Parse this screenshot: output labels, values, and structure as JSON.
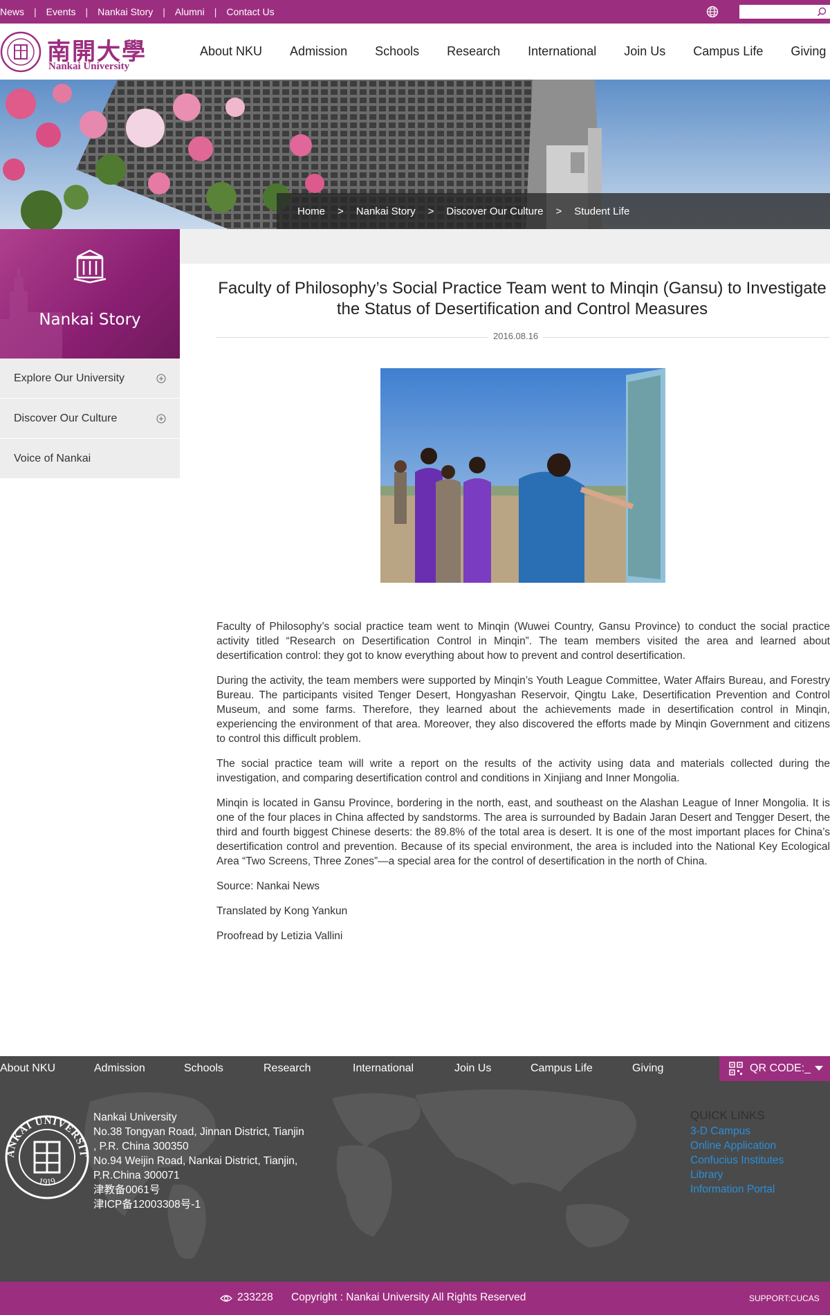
{
  "topbar": {
    "links": [
      "News",
      "Events",
      "Nankai Story",
      "Alumni",
      "Contact Us"
    ],
    "search_placeholder": ""
  },
  "logo": {
    "chinese_name": "南開大學",
    "english_name": "Nankai University"
  },
  "nav": {
    "items": [
      "About NKU",
      "Admission",
      "Schools",
      "Research",
      "International",
      "Join Us",
      "Campus Life",
      "Giving"
    ]
  },
  "breadcrumb": {
    "items": [
      "Home",
      "Nankai Story",
      "Discover Our Culture",
      "Student Life"
    ],
    "separator": ">"
  },
  "sidebar": {
    "title": "Nankai Story",
    "items": [
      {
        "label": "Explore Our University",
        "icon": "plus-circle-icon"
      },
      {
        "label": "Discover Our Culture",
        "icon": "plus-circle-icon"
      },
      {
        "label": "Voice of Nankai"
      }
    ]
  },
  "article": {
    "title_line1": "Faculty of Philosophy’s Social Practice Team went to Minqin (Gansu) to Investigate",
    "title_line2": "the Status of Desertification and Control Measures",
    "date": "2016.08.16",
    "paragraphs": [
      "Faculty of Philosophy’s social practice team went to Minqin (Wuwei Country, Gansu Province) to conduct the social practice activity titled “Research on Desertification Control in Minqin”. The team members visited the area and learned about desertification control: they got to know everything about how to prevent and control desertification.",
      "During the activity, the team members were supported by Minqin’s Youth League Committee, Water Affairs Bureau, and Forestry Bureau. The participants visited Tenger Desert, Hongyashan Reservoir, Qingtu Lake, Desertification Prevention and Control Museum, and some farms. Therefore, they learned about the achievements made in desertification control in Minqin, experiencing the environment of that area. Moreover, they also discovered the efforts made by Minqin Government and citizens to control this difficult problem.",
      "The social practice team will write a report on the results of the activity using data and materials collected during the investigation, and comparing desertification control and conditions in Xinjiang and Inner Mongolia.",
      "Minqin is located in Gansu Province, bordering in the north, east, and southeast on the Alashan League of Inner Mongolia. It is one of the four places in China affected by sandstorms. The area is surrounded by Badain Jaran Desert and Tengger Desert, the third and fourth biggest Chinese deserts: the 89.8% of the total area is desert. It is one of the most important places for China’s desertification control and prevention. Because of its special environment, the area is included into the National Key Ecological Area “Two Screens, Three Zones”—a special area for the control of desertification in the north of China.",
      "Source: Nankai News",
      "Translated by Kong Yankun",
      "Proofread  by Letizia Vallini"
    ]
  },
  "footer": {
    "nav_items": [
      "About NKU",
      "Admission",
      "Schools",
      "Research",
      "International",
      "Join Us",
      "Campus Life",
      "Giving"
    ],
    "qr_label": "QR CODE:_",
    "address_lines": [
      "Nankai University",
      "No.38 Tongyan Road, Jinnan District, Tianjin",
      ", P.R. China 300350",
      "No.94 Weijin Road,  Nankai District, Tianjin,",
      "P.R.China  300071",
      "津教备0061号",
      "津ICP备12003308号-1"
    ],
    "seal_text": "NANKAI UNIVERSITY",
    "seal_year": "1919",
    "quick_links_title": "QUICK LINKS",
    "quick_links": [
      "3-D Campus",
      "Online Application",
      "Confucius Institutes",
      "Library",
      "Information Portal"
    ],
    "visit_count": "233228",
    "copyright": "Copyright : Nankai University All Rights Reserved",
    "support": "SUPPORT:CUCAS"
  },
  "colors": {
    "brand_purple": "#9c2e7f",
    "footer_gray": "#4a4a4a",
    "link_blue": "#2a8fd9"
  }
}
